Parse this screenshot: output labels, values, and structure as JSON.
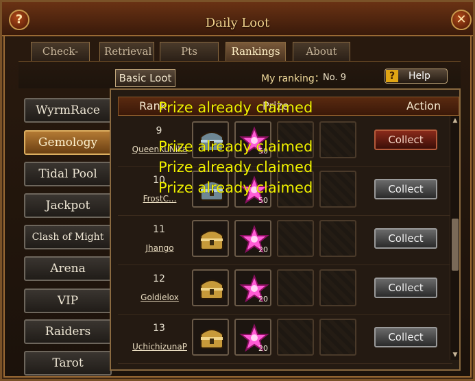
{
  "window": {
    "title": "Daily Loot"
  },
  "tabs": [
    {
      "label": "Check-ins",
      "active": false
    },
    {
      "label": "Retrieval",
      "active": false
    },
    {
      "label": "Pts Chest",
      "active": false
    },
    {
      "label": "Rankings",
      "active": true
    },
    {
      "label": "About",
      "active": false
    }
  ],
  "subbar": {
    "basic_loot": "Basic Loot",
    "my_ranking_label": "My ranking：",
    "my_ranking_value": "No. 9",
    "help_label": "Help",
    "help_icon": "?"
  },
  "sidebar": [
    {
      "label": "WyrmRace",
      "active": false
    },
    {
      "label": "Gemology",
      "active": true
    },
    {
      "label": "Tidal Pool",
      "active": false
    },
    {
      "label": "Jackpot",
      "active": false
    },
    {
      "label": "Clash of Might",
      "active": false
    },
    {
      "label": "Arena",
      "active": false
    },
    {
      "label": "VIP",
      "active": false
    },
    {
      "label": "Raiders",
      "active": false
    },
    {
      "label": "Tarot",
      "active": false
    }
  ],
  "table": {
    "headers": {
      "rank": "Rank",
      "prize": "Prize",
      "action": "Action"
    },
    "rows": [
      {
        "rank": "9",
        "player": "QueenKuNika",
        "chest": "silver",
        "gem_count": "50",
        "action": "Collect",
        "claimed": true
      },
      {
        "rank": "10",
        "player": "FrostC...",
        "chest": "silver",
        "gem_count": "50",
        "action": "Collect",
        "claimed": false
      },
      {
        "rank": "11",
        "player": "Jhango",
        "chest": "gold",
        "gem_count": "20",
        "action": "Collect",
        "claimed": false
      },
      {
        "rank": "12",
        "player": "Goldielox",
        "chest": "gold",
        "gem_count": "20",
        "action": "Collect",
        "claimed": false
      },
      {
        "rank": "13",
        "player": "UchichizunaP",
        "chest": "gold",
        "gem_count": "20",
        "action": "Collect",
        "claimed": false
      }
    ]
  },
  "notices": [
    "Prize already claimed",
    "Prize already claimed",
    "Prize already claimed",
    "Prize already claimed"
  ],
  "colors": {
    "notice": "#f2f200",
    "active_tab_text": "#fff1c7",
    "accent_border": "#9a6a34"
  }
}
